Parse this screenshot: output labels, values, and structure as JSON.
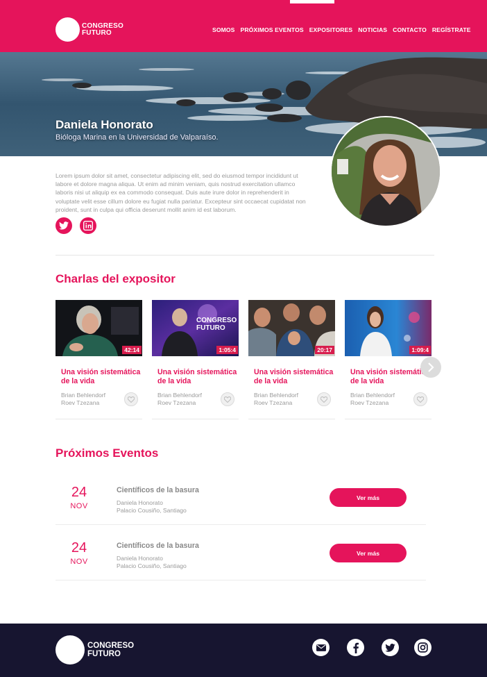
{
  "brand": {
    "line1": "CONGRESO",
    "line2": "FUTURO"
  },
  "nav": {
    "items": [
      "SOMOS",
      "PRÓXIMOS EVENTOS",
      "EXPOSITORES",
      "NOTICIAS",
      "CONTACTO",
      "REGÍSTRATE"
    ],
    "active": "EXPOSITORES"
  },
  "speaker": {
    "name": "Daniela Honorato",
    "role": "Bióloga Marina en la Universidad de Valparaíso.",
    "bio": "Lorem ipsum dolor sit amet, consectetur adipiscing elit, sed do eiusmod tempor incididunt ut labore et dolore magna aliqua. Ut enim ad minim veniam, quis nostrud exercitation ullamco laboris nisi ut aliquip ex ea commodo consequat. Duis aute irure dolor in reprehenderit in voluptate velit esse cillum dolore eu fugiat nulla pariatur. Excepteur sint occaecat cupidatat non proident, sunt in culpa qui officia deserunt mollit anim id est laborum.",
    "social": [
      "twitter-icon",
      "linkedin-icon"
    ]
  },
  "talks": {
    "title": "Charlas del expositor",
    "items": [
      {
        "title": "Una visión sistemática de la vida",
        "duration": "42:14",
        "author1": "Brian Behlendorf",
        "author2": "Roev Tzezana"
      },
      {
        "title": "Una visión sistemática de la vida",
        "duration": "1:05:4",
        "author1": "Brian Behlendorf",
        "author2": "Roev Tzezana"
      },
      {
        "title": "Una visión sistemática de la vida",
        "duration": "20:17",
        "author1": "Brian Behlendorf",
        "author2": "Roev Tzezana"
      },
      {
        "title": "Una visión sistemática de la vida",
        "duration": "1:09:4",
        "author1": "Brian Behlendorf",
        "author2": "Roev Tzezana"
      }
    ],
    "thumb_label_2": "CONGRESO FUTURO"
  },
  "events": {
    "title": "Próximos Eventos",
    "items": [
      {
        "day": "24",
        "month": "NOV",
        "title": "Científicos de la basura",
        "speaker": "Daniela Honorato",
        "place": "Palacio Cousiño, Santiago",
        "button": "Ver más"
      },
      {
        "day": "24",
        "month": "NOV",
        "title": "Científicos de la basura",
        "speaker": "Daniela Honorato",
        "place": "Palacio Cousiño, Santiago",
        "button": "Ver más"
      }
    ]
  },
  "footer": {
    "brand": {
      "line1": "CONGRESO",
      "line2": "FUTURO"
    },
    "social": [
      "mail-icon",
      "facebook-icon",
      "twitter-icon",
      "instagram-icon"
    ]
  },
  "colors": {
    "accent": "#e5145b",
    "footer_bg": "#171530"
  }
}
